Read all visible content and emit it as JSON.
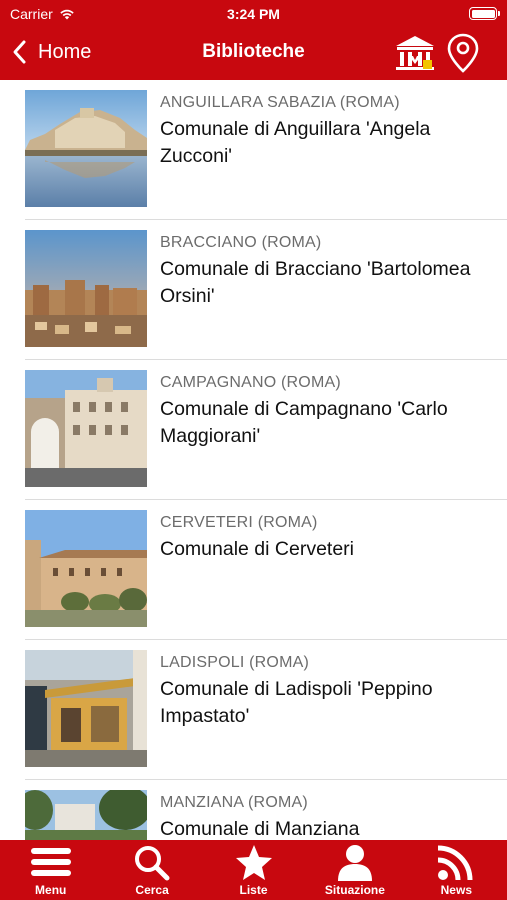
{
  "status_bar": {
    "carrier": "Carrier",
    "time": "3:24 PM"
  },
  "nav": {
    "back_label": "Home",
    "title": "Biblioteche"
  },
  "libraries": [
    {
      "city": "ANGUILLARA SABAZIA (ROMA)",
      "name": "Comunale di Anguillara 'Angela Zucconi'"
    },
    {
      "city": "BRACCIANO (ROMA)",
      "name": "Comunale di Bracciano 'Bartolomea Orsini'"
    },
    {
      "city": "CAMPAGNANO (ROMA)",
      "name": "Comunale di Campagnano 'Carlo Maggiorani'"
    },
    {
      "city": "CERVETERI (ROMA)",
      "name": "Comunale di Cerveteri"
    },
    {
      "city": "LADISPOLI (ROMA)",
      "name": "Comunale di Ladispoli 'Peppino Impastato'"
    },
    {
      "city": "MANZIANA (ROMA)",
      "name": "Comunale di Manziana"
    }
  ],
  "tabs": [
    {
      "label": "Menu",
      "icon": "hamburger-icon"
    },
    {
      "label": "Cerca",
      "icon": "search-icon"
    },
    {
      "label": "Liste",
      "icon": "star-icon"
    },
    {
      "label": "Situazione",
      "icon": "user-icon"
    },
    {
      "label": "News",
      "icon": "rss-icon"
    }
  ],
  "colors": {
    "brand_red": "#c8080f",
    "accent_yellow": "#f2c400"
  }
}
